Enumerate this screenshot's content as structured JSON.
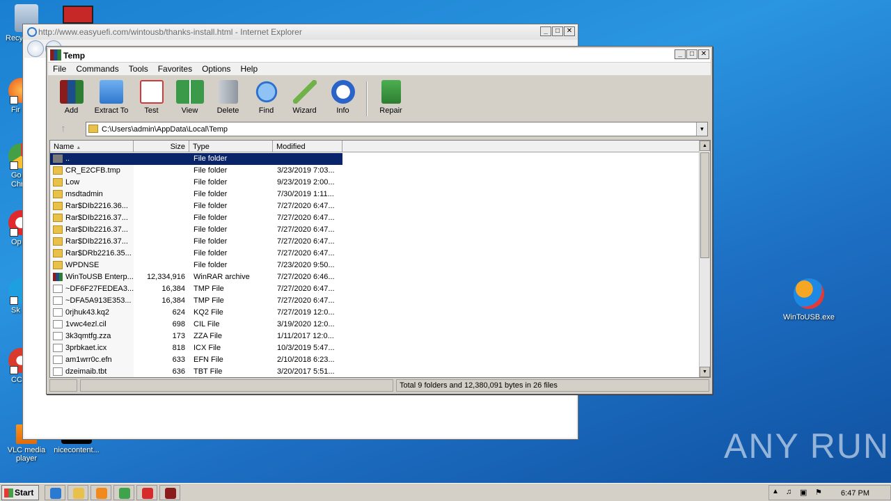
{
  "desktop": {
    "icons": [
      {
        "label": "Recy"
      },
      {
        "label": "Fir"
      },
      {
        "label": "Go\nChr"
      },
      {
        "label": "Op"
      },
      {
        "label": "Sk"
      },
      {
        "label": "CCl"
      },
      {
        "label": "VLC media player"
      },
      {
        "label": "nicecontent..."
      },
      {
        "label": "WinToUSB.exe"
      }
    ],
    "watermark": "ANY RUN"
  },
  "ie": {
    "title": "http://www.easyuefi.com/wintousb/thanks-install.html - Internet Explorer",
    "min": "_",
    "max": "□",
    "close": "✕"
  },
  "winrar": {
    "title": "Temp",
    "menu": [
      "File",
      "Commands",
      "Tools",
      "Favorites",
      "Options",
      "Help"
    ],
    "toolbar": [
      {
        "label": "Add",
        "icon": "add-archive-icon",
        "color": "#b8332b"
      },
      {
        "label": "Extract To",
        "icon": "extract-folder-icon",
        "color": "#3f8ee0"
      },
      {
        "label": "Test",
        "icon": "test-checklist-icon",
        "color": "#cf3b3b"
      },
      {
        "label": "View",
        "icon": "view-book-icon",
        "color": "#3a9a4a"
      },
      {
        "label": "Delete",
        "icon": "trash-icon",
        "color": "#9aa3ad"
      },
      {
        "label": "Find",
        "icon": "magnifier-icon",
        "color": "#2c6fcf"
      },
      {
        "label": "Wizard",
        "icon": "wand-icon",
        "color": "#6fb24a"
      },
      {
        "label": "Info",
        "icon": "info-icon",
        "color": "#2a64c8"
      },
      {
        "label": "Repair",
        "icon": "repair-kit-icon",
        "color": "#2f8f3a"
      }
    ],
    "path": "C:\\Users\\admin\\AppData\\Local\\Temp",
    "columns": {
      "name": "Name",
      "size": "Size",
      "type": "Type",
      "modified": "Modified"
    },
    "files": [
      {
        "name": "..",
        "size": "",
        "type": "File folder",
        "modified": "",
        "kind": "up",
        "selected": true
      },
      {
        "name": "CR_E2CFB.tmp",
        "size": "",
        "type": "File folder",
        "modified": "3/23/2019 7:03...",
        "kind": "folder"
      },
      {
        "name": "Low",
        "size": "",
        "type": "File folder",
        "modified": "9/23/2019 2:00...",
        "kind": "folder"
      },
      {
        "name": "msdtadmin",
        "size": "",
        "type": "File folder",
        "modified": "7/30/2019 1:11...",
        "kind": "folder"
      },
      {
        "name": "Rar$DIb2216.36...",
        "size": "",
        "type": "File folder",
        "modified": "7/27/2020 6:47...",
        "kind": "folder"
      },
      {
        "name": "Rar$DIb2216.37...",
        "size": "",
        "type": "File folder",
        "modified": "7/27/2020 6:47...",
        "kind": "folder"
      },
      {
        "name": "Rar$DIb2216.37...",
        "size": "",
        "type": "File folder",
        "modified": "7/27/2020 6:47...",
        "kind": "folder"
      },
      {
        "name": "Rar$DIb2216.37...",
        "size": "",
        "type": "File folder",
        "modified": "7/27/2020 6:47...",
        "kind": "folder"
      },
      {
        "name": "Rar$DRb2216.35...",
        "size": "",
        "type": "File folder",
        "modified": "7/27/2020 6:47...",
        "kind": "folder"
      },
      {
        "name": "WPDNSE",
        "size": "",
        "type": "File folder",
        "modified": "7/23/2020 9:50...",
        "kind": "folder"
      },
      {
        "name": "WinToUSB Enterp...",
        "size": "12,334,916",
        "type": "WinRAR archive",
        "modified": "7/27/2020 6:46...",
        "kind": "rar"
      },
      {
        "name": "~DF6F27FEDEA3...",
        "size": "16,384",
        "type": "TMP File",
        "modified": "7/27/2020 6:47...",
        "kind": "file"
      },
      {
        "name": "~DFA5A913E353...",
        "size": "16,384",
        "type": "TMP File",
        "modified": "7/27/2020 6:47...",
        "kind": "file"
      },
      {
        "name": "0rjhuk43.kq2",
        "size": "624",
        "type": "KQ2 File",
        "modified": "7/27/2019 12:0...",
        "kind": "file"
      },
      {
        "name": "1vwc4ezl.cil",
        "size": "698",
        "type": "CIL File",
        "modified": "3/19/2020 12:0...",
        "kind": "file"
      },
      {
        "name": "3k3qmtfg.zza",
        "size": "173",
        "type": "ZZA File",
        "modified": "1/11/2017 12:0...",
        "kind": "file"
      },
      {
        "name": "3prbkaet.icx",
        "size": "818",
        "type": "ICX File",
        "modified": "10/3/2019 5:47...",
        "kind": "file"
      },
      {
        "name": "am1wrr0c.efn",
        "size": "633",
        "type": "EFN File",
        "modified": "2/10/2018 6:23...",
        "kind": "file"
      },
      {
        "name": "dzeimaib.tbt",
        "size": "636",
        "type": "TBT File",
        "modified": "3/20/2017 5:51...",
        "kind": "file"
      }
    ],
    "status": "Total 9 folders and 12,380,091 bytes in 26 files"
  },
  "taskbar": {
    "start": "Start",
    "apps": [
      {
        "icon": "internet-explorer-icon",
        "color": "#2a7ad1"
      },
      {
        "icon": "explorer-folder-icon",
        "color": "#e8c14a"
      },
      {
        "icon": "media-player-icon",
        "color": "#f08a1c"
      },
      {
        "icon": "chrome-icon",
        "color": "#3fa34d"
      },
      {
        "icon": "opera-icon",
        "color": "#d62b2b"
      },
      {
        "icon": "winrar-icon",
        "color": "#8b1c1c"
      }
    ],
    "clock": "6:47 PM"
  }
}
